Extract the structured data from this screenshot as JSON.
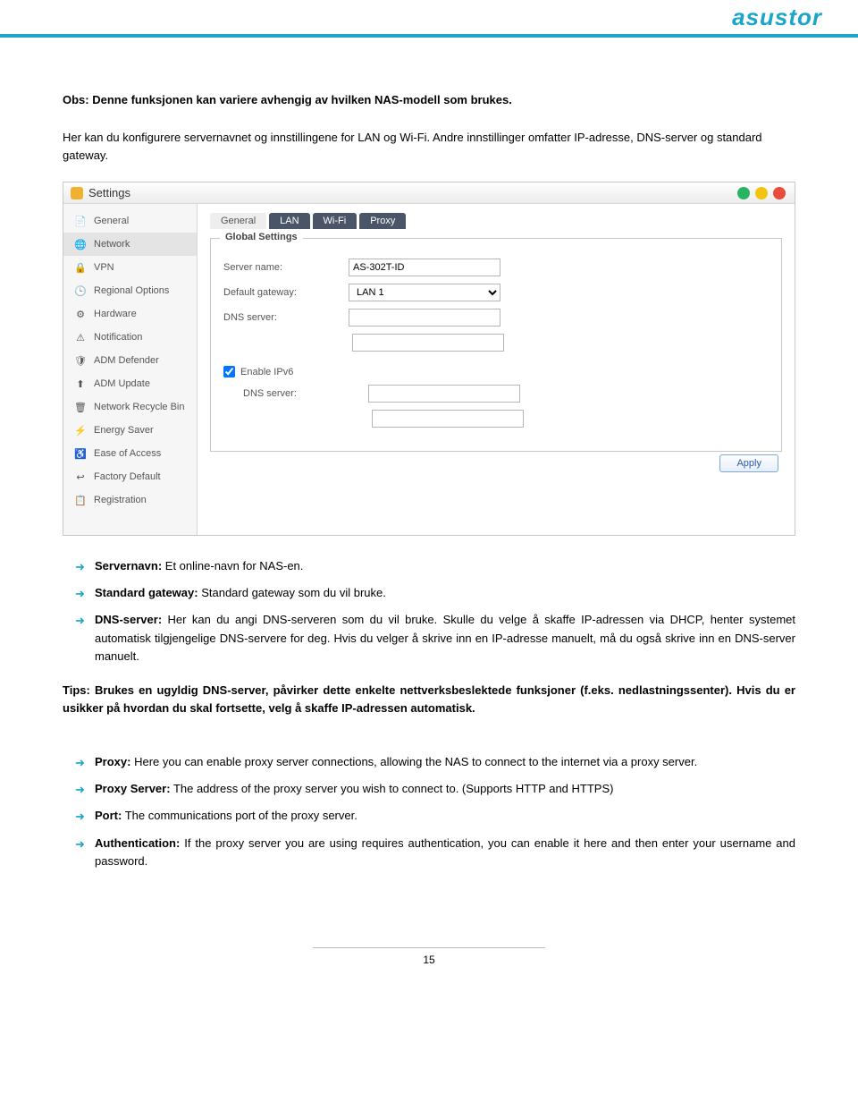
{
  "header": {
    "brand": "asustor"
  },
  "intro": {
    "line1_strong": "Obs: Denne funksjonen kan variere avhengig av hvilken NAS-modell som brukes.",
    "line2": "Her kan du konfigurere servernavnet og innstillingene for LAN og Wi-Fi. Andre innstillinger omfatter IP-adresse, DNS-server og standard gateway."
  },
  "settings": {
    "title": "Settings",
    "sidebar": [
      {
        "label": "General",
        "icon": "📄",
        "name": "sidebar-item-general",
        "active": false
      },
      {
        "label": "Network",
        "icon": "🌐",
        "name": "sidebar-item-network",
        "active": true
      },
      {
        "label": "VPN",
        "icon": "🔒",
        "name": "sidebar-item-vpn",
        "active": false
      },
      {
        "label": "Regional Options",
        "icon": "🕒",
        "name": "sidebar-item-regional",
        "active": false
      },
      {
        "label": "Hardware",
        "icon": "⚙",
        "name": "sidebar-item-hardware",
        "active": false
      },
      {
        "label": "Notification",
        "icon": "⚠",
        "name": "sidebar-item-notification",
        "active": false
      },
      {
        "label": "ADM Defender",
        "icon": "🛡",
        "name": "sidebar-item-defender",
        "active": false
      },
      {
        "label": "ADM Update",
        "icon": "⬆",
        "name": "sidebar-item-update",
        "active": false
      },
      {
        "label": "Network Recycle Bin",
        "icon": "🗑",
        "name": "sidebar-item-recycle",
        "active": false
      },
      {
        "label": "Energy Saver",
        "icon": "⚡",
        "name": "sidebar-item-energy",
        "active": false
      },
      {
        "label": "Ease of Access",
        "icon": "♿",
        "name": "sidebar-item-access",
        "active": false
      },
      {
        "label": "Factory Default",
        "icon": "↩",
        "name": "sidebar-item-factory",
        "active": false
      },
      {
        "label": "Registration",
        "icon": "📋",
        "name": "sidebar-item-registration",
        "active": false
      }
    ],
    "tabs": [
      {
        "label": "General",
        "name": "tab-general",
        "dark": false
      },
      {
        "label": "LAN",
        "name": "tab-lan",
        "dark": true
      },
      {
        "label": "Wi-Fi",
        "name": "tab-wifi",
        "dark": true
      },
      {
        "label": "Proxy",
        "name": "tab-proxy",
        "dark": true
      }
    ],
    "form": {
      "legend": "Global Settings",
      "server_name_label": "Server name:",
      "server_name_value": "AS-302T-ID",
      "default_gateway_label": "Default gateway:",
      "default_gateway_value": "LAN 1",
      "dns_server_label": "DNS server:",
      "dns_server_value1": "",
      "dns_server_value2": "",
      "enable_ipv6_label": "Enable IPv6",
      "enable_ipv6_checked": true,
      "ipv6_dns_label": "DNS server:",
      "ipv6_dns_value1": "",
      "ipv6_dns_value2": ""
    },
    "apply": "Apply"
  },
  "bullets1": [
    {
      "bold": "Servernavn:",
      "rest": " Et online-navn for NAS-en."
    },
    {
      "bold": "Standard gateway:",
      "rest": " Standard gateway som du vil bruke."
    },
    {
      "bold": "DNS-server:",
      "rest": " Her kan du angi DNS-serveren som du vil bruke. Skulle du velge å skaffe IP-adressen via DHCP, henter systemet automatisk tilgjengelige DNS-servere for deg. Hvis du velger å skrive inn en IP-adresse manuelt, må du også skrive inn en DNS-server manuelt."
    }
  ],
  "tip": "Tips: Brukes en ugyldig DNS-server, påvirker dette enkelte nettverksbeslektede funksjoner (f.eks. nedlastningssenter). Hvis du er usikker på hvordan du skal fortsette, velg å skaffe IP-adressen automatisk.",
  "bullets2": [
    {
      "bold": "Proxy:",
      "rest": " Here you can enable proxy server connections, allowing the NAS to connect to the internet via a proxy server."
    },
    {
      "bold": "Proxy Server:",
      "rest": " The address of the proxy server you wish to connect to. (Supports HTTP and HTTPS)"
    },
    {
      "bold": "Port:",
      "rest": " The communications port of the proxy server."
    },
    {
      "bold": "Authentication:",
      "rest": " If the proxy server you are using requires authentication, you can enable it here and then enter your username and password."
    }
  ],
  "page_number": "15"
}
